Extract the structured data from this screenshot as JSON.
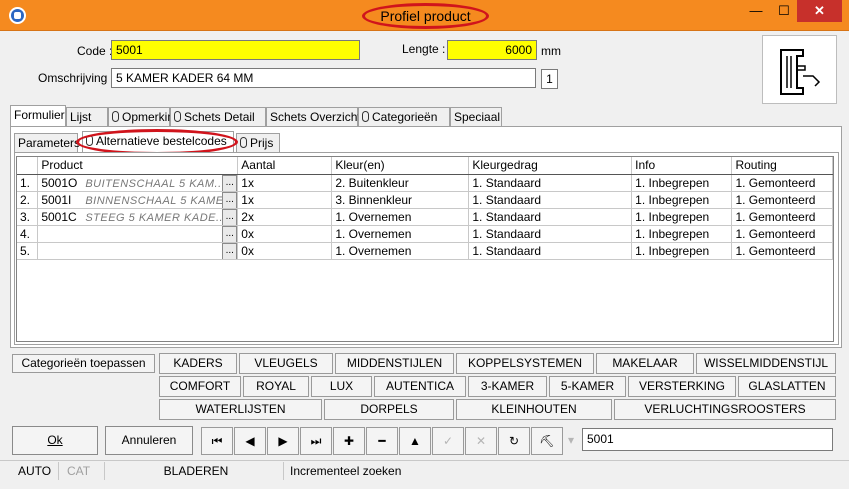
{
  "window": {
    "title": "Profiel product",
    "minimize_icon": "minimize-icon",
    "maximize_icon": "maximize-icon",
    "close_icon": "close-icon"
  },
  "header": {
    "code_label": "Code :",
    "code_value": "5001",
    "length_label": "Lengte :",
    "length_value": "6000",
    "length_unit": "mm",
    "description_label": "Omschrijving :",
    "description_value": "5 KAMER KADER 64 MM",
    "count_value": "1"
  },
  "main_tabs": [
    "Formulier",
    "Lijst",
    "Opmerking",
    "Schets Detail",
    "Schets Overzicht",
    "Categorieën",
    "Speciaal"
  ],
  "sub_tabs": [
    "Parameters",
    "Alternatieve bestelcodes",
    "Prijs"
  ],
  "grid": {
    "columns": [
      "Product",
      "Aantal",
      "Kleur(en)",
      "Kleurgedrag",
      "Info",
      "Routing"
    ],
    "rows": [
      {
        "num": "1.",
        "code": "5001O",
        "desc": "BUITENSCHAAL 5 KAM...",
        "aantal": "1x",
        "kleur": "2. Buitenkleur",
        "gedrag": "1. Standaard",
        "info": "1. Inbegrepen",
        "routing": "1. Gemonteerd"
      },
      {
        "num": "2.",
        "code": "5001I",
        "desc": "BINNENSCHAAL 5 KAME...",
        "aantal": "1x",
        "kleur": "3. Binnenkleur",
        "gedrag": "1. Standaard",
        "info": "1. Inbegrepen",
        "routing": "1. Gemonteerd"
      },
      {
        "num": "3.",
        "code": "5001C",
        "desc": "STEEG 5 KAMER KADE...",
        "aantal": "2x",
        "kleur": "1. Overnemen",
        "gedrag": "1. Standaard",
        "info": "1. Inbegrepen",
        "routing": "1. Gemonteerd"
      },
      {
        "num": "4.",
        "code": "",
        "desc": "",
        "aantal": "0x",
        "kleur": "1. Overnemen",
        "gedrag": "1. Standaard",
        "info": "1. Inbegrepen",
        "routing": "1. Gemonteerd"
      },
      {
        "num": "5.",
        "code": "",
        "desc": "",
        "aantal": "0x",
        "kleur": "1. Overnemen",
        "gedrag": "1. Standaard",
        "info": "1. Inbegrepen",
        "routing": "1. Gemonteerd"
      }
    ],
    "ellipsis": "..."
  },
  "category_button": "Categorieën toepassen",
  "categories_row1": [
    "KADERS",
    "VLEUGELS",
    "MIDDENSTIJLEN",
    "KOPPELSYSTEMEN",
    "MAKELAAR",
    "WISSELMIDDENSTIJL"
  ],
  "categories_row2": [
    "COMFORT",
    "ROYAL",
    "LUX",
    "AUTENTICA",
    "3-KAMER",
    "5-KAMER",
    "VERSTERKING",
    "GLASLATTEN"
  ],
  "categories_row3": [
    "WATERLIJSTEN",
    "DORPELS",
    "KLEINHOUTEN",
    "VERLUCHTINGSROOSTERS"
  ],
  "actions": {
    "ok": "Ok",
    "cancel": "Annuleren"
  },
  "nav_icons": [
    "first-icon",
    "prev-icon",
    "next-icon",
    "last-icon",
    "add-icon",
    "delete-icon",
    "up-icon",
    "confirm-icon",
    "cancel-edit-icon",
    "refresh-icon",
    "binoculars-icon",
    "dropdown-icon"
  ],
  "nav_glyphs": [
    "⏮",
    "◀",
    "▶",
    "⏭",
    "✚",
    "━",
    "▲",
    "✓",
    "✕",
    "↻",
    "⛏",
    "▾"
  ],
  "search_value": "5001",
  "status": {
    "mode1": "AUTO",
    "mode2": "CAT",
    "state": "BLADEREN",
    "hint": "Incrementeel zoeken"
  },
  "colors": {
    "titlebar": "#f58a1f",
    "highlight": "#ffff00",
    "annotation": "#d0141c",
    "close": "#c7302b"
  }
}
